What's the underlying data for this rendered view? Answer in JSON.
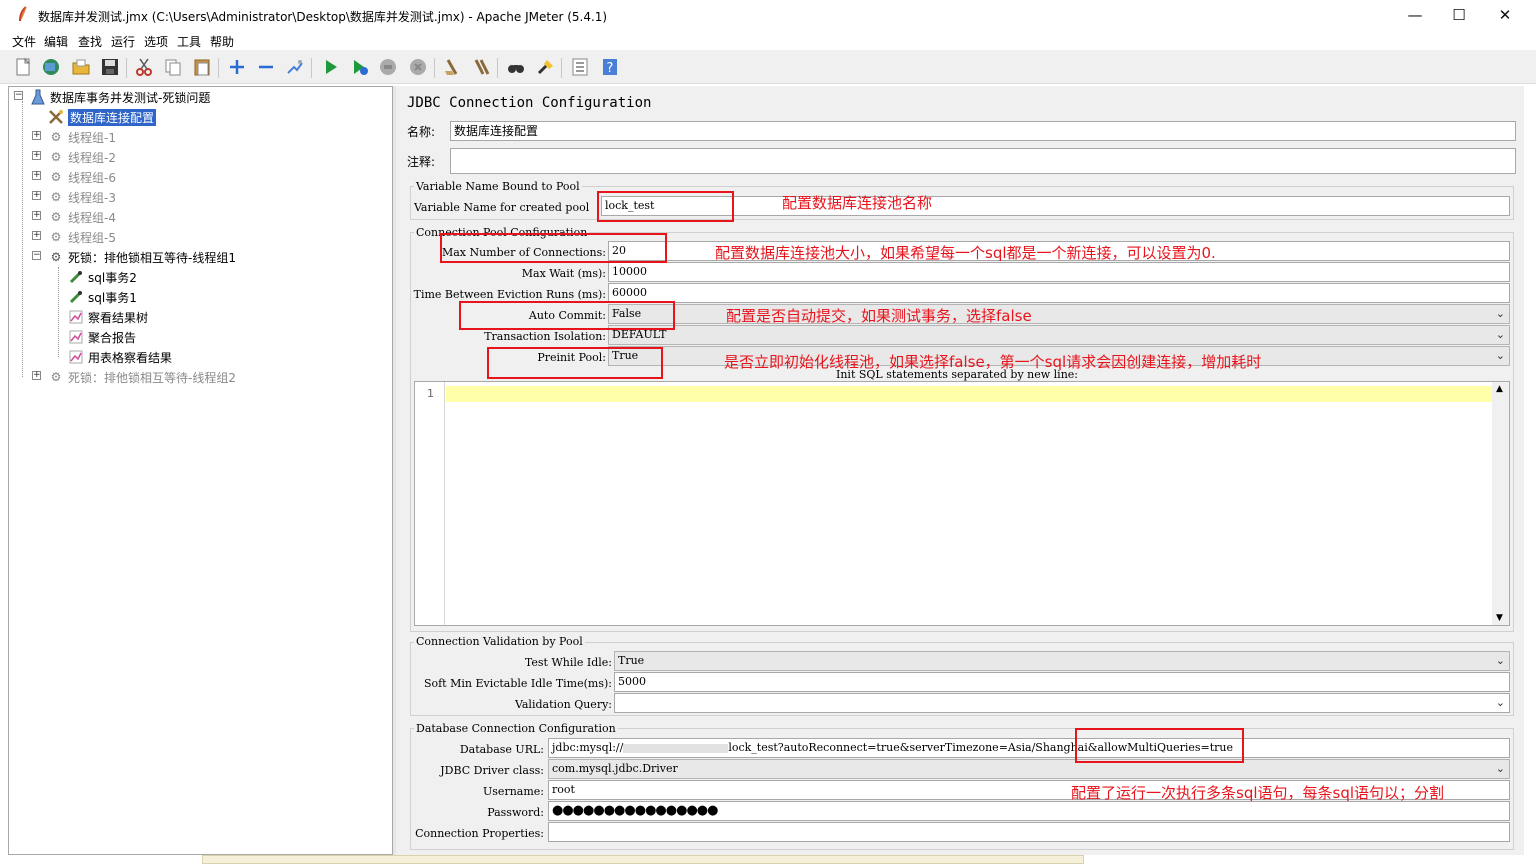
{
  "window": {
    "title": "数据库并发测试.jmx (C:\\Users\\Administrator\\Desktop\\数据库并发测试.jmx) - Apache JMeter (5.4.1)",
    "minimize": "—",
    "maximize": "☐",
    "close": "✕"
  },
  "menu": [
    "文件",
    "编辑",
    "查找",
    "运行",
    "选项",
    "工具",
    "帮助"
  ],
  "toolbar": {
    "icons": [
      "new-icon",
      "templates-icon",
      "open-icon",
      "save-icon",
      "cut-icon",
      "copy-icon",
      "paste-icon",
      "expand-icon",
      "collapse-icon",
      "toggle-icon",
      "start-icon",
      "start-no-pause-icon",
      "stop-icon",
      "shutdown-icon",
      "clear-icon",
      "clear-all-icon",
      "search-icon",
      "reset-search-icon",
      "function-helper-icon",
      "help-icon"
    ]
  },
  "tree": {
    "root": "数据库事务并发测试-死锁问题",
    "items": [
      {
        "label": "数据库连接配置",
        "selected": true
      },
      {
        "label": "线程组-1",
        "disabled": true
      },
      {
        "label": "线程组-2",
        "disabled": true
      },
      {
        "label": "线程组-6",
        "disabled": true
      },
      {
        "label": "线程组-3",
        "disabled": true
      },
      {
        "label": "线程组-4",
        "disabled": true
      },
      {
        "label": "线程组-5",
        "disabled": true
      },
      {
        "label": "死锁：排他锁相互等待-线程组1",
        "children": [
          "sql事务2",
          "sql事务1",
          "察看结果树",
          "聚合报告",
          "用表格察看结果"
        ]
      },
      {
        "label": "死锁：排他锁相互等待-线程组2",
        "disabled": true
      }
    ]
  },
  "form": {
    "title": "JDBC Connection Configuration",
    "name_label": "名称:",
    "name_value": "数据库连接配置",
    "comment_label": "注释:",
    "comment_value": "",
    "group_pool": "Variable Name Bound to Pool",
    "var_name_label": "Variable Name for created pool",
    "var_name_value": "lock_test",
    "group_conn_pool": "Connection Pool Configuration",
    "max_conn_label": "Max Number of Connections:",
    "max_conn_value": "20",
    "max_wait_label": "Max Wait (ms):",
    "max_wait_value": "10000",
    "eviction_label": "Time Between Eviction Runs (ms):",
    "eviction_value": "60000",
    "auto_commit_label": "Auto Commit:",
    "auto_commit_value": "False",
    "isolation_label": "Transaction Isolation:",
    "isolation_value": "DEFAULT",
    "preinit_label": "Preinit Pool:",
    "preinit_value": "True",
    "init_sql_label": "Init SQL statements separated by new line:",
    "line_number": "1",
    "group_validation": "Connection Validation by Pool",
    "test_idle_label": "Test While Idle:",
    "test_idle_value": "True",
    "soft_min_label": "Soft Min Evictable Idle Time(ms):",
    "soft_min_value": "5000",
    "validation_query_label": "Validation Query:",
    "validation_query_value": "",
    "group_db": "Database Connection Configuration",
    "db_url_label": "Database URL:",
    "db_url_prefix": "jdbc:mysql://",
    "db_url_suffix": "lock_test?autoReconnect=true&serverTimezone=Asia/Shanghai&allowMultiQueries=true",
    "driver_label": "JDBC Driver class:",
    "driver_value": "com.mysql.jdbc.Driver",
    "username_label": "Username:",
    "username_value": "root",
    "password_label": "Password:",
    "password_value": "●●●●●●●●●●●●●●●●",
    "conn_props_label": "Connection Properties:",
    "conn_props_value": ""
  },
  "annotations": {
    "pool_name": "配置数据库连接池名称",
    "max_conn": "配置数据库连接池大小，如果希望每一个sql都是一个新连接，可以设置为0.",
    "auto_commit": "配置是否自动提交，如果测试事务，选择false",
    "preinit": "是否立即初始化线程池，如果选择false，第一个sql请求会因创建连接，增加耗时",
    "multi_queries": "配置了运行一次执行多条sql语句，每条sql语句以；分割"
  },
  "colors": {
    "annotation_red": "#e8141c",
    "selection_blue": "#2f65c8",
    "current_line": "#ffffaa"
  }
}
